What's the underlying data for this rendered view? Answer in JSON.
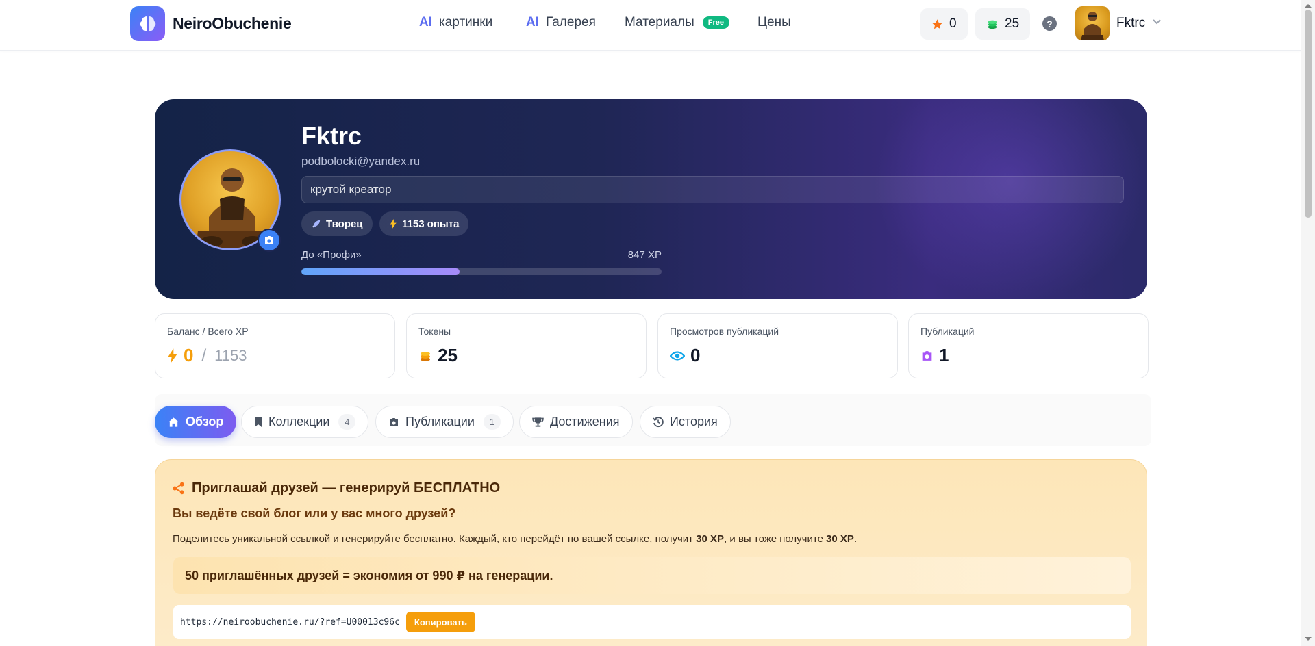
{
  "header": {
    "logo_text": "NeiroObuchenie",
    "nav": [
      {
        "prefix": "AI",
        "label": "картинки"
      },
      {
        "prefix": "AI",
        "label": "Галерея"
      },
      {
        "label": "Материалы",
        "badge": "Free"
      },
      {
        "label": "Цены"
      }
    ],
    "stars_count": "0",
    "tokens_count": "25",
    "help_label": "?",
    "user_name": "Fktrc"
  },
  "profile": {
    "name": "Fktrc",
    "email": "podbolocki@yandex.ru",
    "bio": "крутой креатор",
    "chips": [
      {
        "label": "Творец",
        "icon": "rocket-icon"
      },
      {
        "label": "1153 опыта",
        "icon": "lightning-icon"
      }
    ],
    "progress": {
      "label": "До «Профи»",
      "value_text": "847 XP",
      "fraction": 0.44
    }
  },
  "stats": [
    {
      "label": "Баланс / Всего XP",
      "value": "0",
      "total": "1153",
      "icon": "lightning-icon"
    },
    {
      "label": "Токены",
      "value": "25",
      "icon": "coins-icon"
    },
    {
      "label": "Просмотров публикаций",
      "value": "0",
      "icon": "eye-icon"
    },
    {
      "label": "Публикаций",
      "value": "1",
      "icon": "camera-icon"
    }
  ],
  "tabs": [
    {
      "label": "Обзор",
      "active": true,
      "icon": "home-icon"
    },
    {
      "label": "Коллекции",
      "count": "4",
      "icon": "bookmark-icon"
    },
    {
      "label": "Публикации",
      "count": "1",
      "icon": "camera-icon"
    },
    {
      "label": "Достижения",
      "icon": "trophy-icon"
    },
    {
      "label": "История",
      "icon": "history-icon"
    }
  ],
  "referral": {
    "title": "Приглашай друзей — генерируй БЕСПЛАТНО",
    "subtitle": "Вы ведёте свой блог или у вас много друзей?",
    "desc_part1": "Поделитесь уникальной ссылкой и генерируйте бесплатно. Каждый, кто перейдёт по вашей ссылке, получит ",
    "desc_bonus1": "30 XP",
    "desc_part2": ", и вы тоже получите ",
    "desc_bonus2": "30 XP",
    "desc_part3": ".",
    "highlight": "50 приглашённых друзей = экономия от 990 ₽ на генерации.",
    "link": "https://neiroobuchenie.ru/?ref=U00013c96c",
    "copy_label": "Копировать"
  },
  "colors": {
    "accent_blue": "#3b82f6",
    "accent_purple": "#8b5cf6",
    "hero_dark": "#1f2655",
    "orange": "#f59e0b",
    "free_green": "#10b981"
  }
}
